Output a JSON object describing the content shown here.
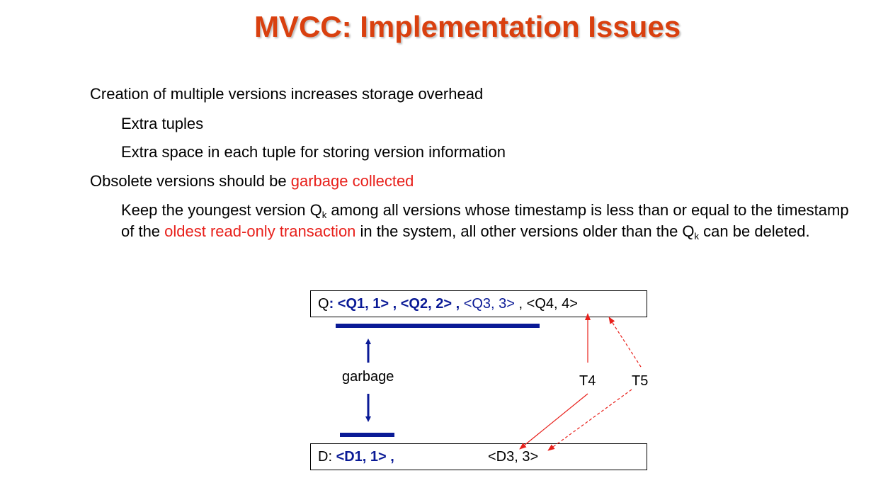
{
  "title": "MVCC: Implementation Issues",
  "bullets": {
    "b1": "Creation of multiple versions increases storage overhead",
    "b1a": "Extra tuples",
    "b1b": "Extra space in each tuple for storing version information",
    "b2_pre": "Obsolete versions should be ",
    "b2_red": "garbage collected",
    "p_1": "Keep the youngest version Q",
    "p_sub": "k",
    "p_2": " among all versions whose timestamp is less than or equal to the timestamp of the ",
    "p_red": "oldest read-only transaction",
    "p_3": " in the system, all other versions older than the Q",
    "p_sub2": "k",
    "p_4": " can be deleted."
  },
  "diagram": {
    "q_label": "Q",
    "q_v1": ": <Q1, 1> , ",
    "q_v2": " <Q2, 2> , ",
    "q_v3": " <Q3,  3> ",
    "q_v4": " , <Q4, 4>",
    "d_label": "D: ",
    "d_v1": "<D1, 1> ,",
    "d_v3": "<D3,  3>",
    "garbage": "garbage",
    "t4": "T4",
    "t5": "T5"
  }
}
